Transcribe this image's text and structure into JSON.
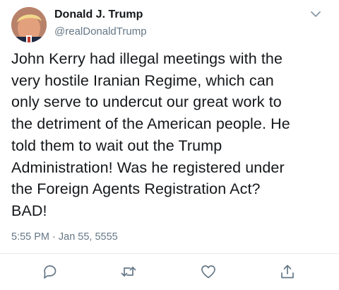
{
  "tweet": {
    "display_name": "Donald J. Trump",
    "handle": "@realDonaldTrump",
    "text": "John Kerry had illegal meetings with the\nvery hostile Iranian Regime, which can\nonly serve to undercut our great work to\nthe detriment of the American people. He\ntold them to wait out the Trump\nAdministration! Was he registered under\nthe Foreign Agents Registration Act?\nBAD!",
    "timestamp": "5:55 PM · Jan 55, 5555"
  },
  "icons": {
    "menu": "chevron-down-icon",
    "reply": "reply-icon",
    "retweet": "retweet-icon",
    "like": "heart-icon",
    "share": "share-icon"
  },
  "colors": {
    "text": "#14171a",
    "secondary": "#657786",
    "icon": "#657786",
    "divider": "#e6ecf0"
  }
}
